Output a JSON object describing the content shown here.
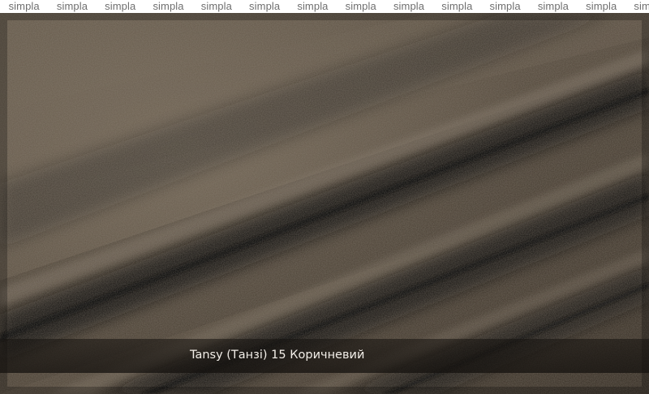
{
  "watermark": {
    "text": "simpla",
    "repeat": 14,
    "color": "#6f6f6f",
    "background": "#ffffff"
  },
  "product": {
    "caption": "Tansy (Танзі) 15 Коричневий"
  },
  "colors": {
    "fabric_base": "#5e5346",
    "fabric_light": "#7c705f",
    "fabric_shadow": "#1d1914",
    "caption_text": "#f2eee8"
  }
}
